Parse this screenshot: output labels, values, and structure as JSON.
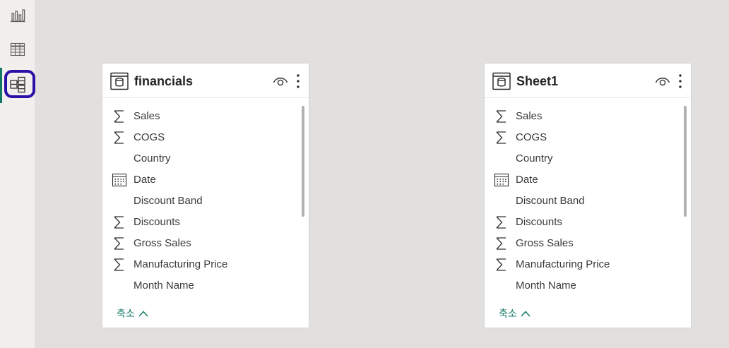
{
  "nav": {
    "items": [
      {
        "icon": "report-view-icon"
      },
      {
        "icon": "data-view-icon"
      },
      {
        "icon": "model-view-icon",
        "active": true
      }
    ],
    "accent_color": "#117865",
    "highlight_color": "#2a0fa8"
  },
  "tables": [
    {
      "name": "financials",
      "fields": [
        {
          "name": "Sales",
          "type": "sum"
        },
        {
          "name": "COGS",
          "type": "sum"
        },
        {
          "name": "Country",
          "type": "text"
        },
        {
          "name": "Date",
          "type": "date"
        },
        {
          "name": "Discount Band",
          "type": "text"
        },
        {
          "name": "Discounts",
          "type": "sum"
        },
        {
          "name": "Gross Sales",
          "type": "sum"
        },
        {
          "name": "Manufacturing Price",
          "type": "sum"
        },
        {
          "name": "Month Name",
          "type": "text"
        }
      ],
      "collapse_label": "축소"
    },
    {
      "name": "Sheet1",
      "fields": [
        {
          "name": "Sales",
          "type": "sum"
        },
        {
          "name": "COGS",
          "type": "sum"
        },
        {
          "name": "Country",
          "type": "text"
        },
        {
          "name": "Date",
          "type": "date"
        },
        {
          "name": "Discount Band",
          "type": "text"
        },
        {
          "name": "Discounts",
          "type": "sum"
        },
        {
          "name": "Gross Sales",
          "type": "sum"
        },
        {
          "name": "Manufacturing Price",
          "type": "sum"
        },
        {
          "name": "Month Name",
          "type": "text"
        }
      ],
      "collapse_label": "축소"
    }
  ]
}
